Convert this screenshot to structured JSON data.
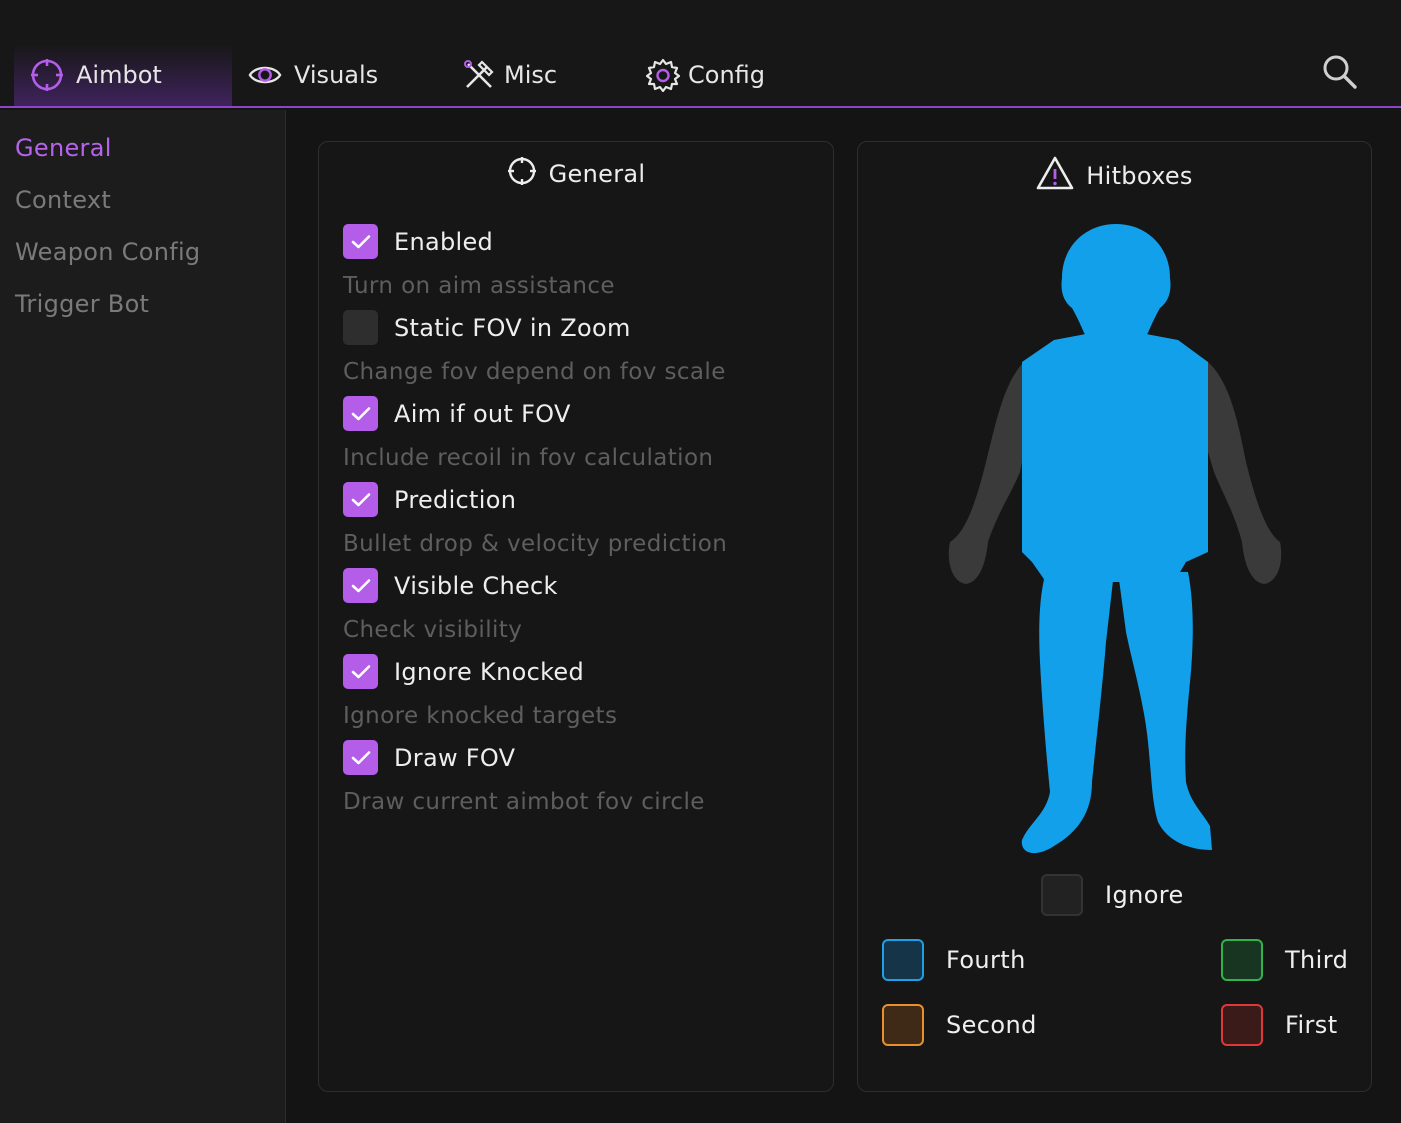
{
  "tabs": [
    {
      "label": "Aimbot",
      "icon": "crosshair-icon",
      "active": true
    },
    {
      "label": "Visuals",
      "icon": "eye-icon",
      "active": false
    },
    {
      "label": "Misc",
      "icon": "tools-icon",
      "active": false
    },
    {
      "label": "Config",
      "icon": "gear-icon",
      "active": false
    }
  ],
  "sidebar": {
    "items": [
      {
        "label": "General",
        "active": true
      },
      {
        "label": "Context",
        "active": false
      },
      {
        "label": "Weapon Config",
        "active": false
      },
      {
        "label": "Trigger Bot",
        "active": false
      }
    ]
  },
  "general_panel": {
    "title": "General",
    "options": [
      {
        "label": "Enabled",
        "description": "Turn on aim assistance",
        "checked": true
      },
      {
        "label": "Static FOV in Zoom",
        "description": "Change fov depend on fov scale",
        "checked": false
      },
      {
        "label": "Aim if out FOV",
        "description": "Include recoil in fov calculation",
        "checked": true
      },
      {
        "label": "Prediction",
        "description": "Bullet drop & velocity prediction",
        "checked": true
      },
      {
        "label": "Visible Check",
        "description": "Check visibility",
        "checked": true
      },
      {
        "label": "Ignore Knocked",
        "description": "Ignore knocked targets",
        "checked": true
      },
      {
        "label": "Draw FOV",
        "description": "Draw current aimbot fov circle",
        "checked": true
      }
    ]
  },
  "hitbox_panel": {
    "title": "Hitboxes",
    "legend": {
      "ignore": {
        "label": "Ignore",
        "color": "#2a2a2a"
      },
      "fourth": {
        "label": "Fourth",
        "color": "#1ea0e6"
      },
      "third": {
        "label": "Third",
        "color": "#2fb34a"
      },
      "second": {
        "label": "Second",
        "color": "#e8902c"
      },
      "first": {
        "label": "First",
        "color": "#e03838"
      }
    }
  },
  "colors": {
    "accent": "#b35de9",
    "hitbox_selected": "#12a0ea",
    "hitbox_ignored": "#3a3a3a"
  }
}
